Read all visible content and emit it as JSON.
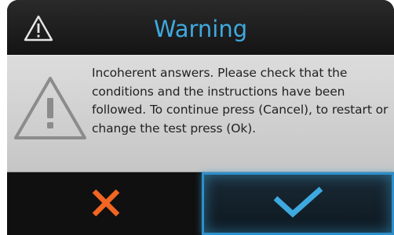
{
  "dialog": {
    "title": "Warning",
    "message": "Incoherent answers. Please check that the conditions and the instructions have been followed. To continue press (Cancel), to restart or change the test press (Ok).",
    "title_color": "#3ea9df"
  },
  "buttons": {
    "cancel": {
      "icon": "close-icon",
      "color": "#f26522"
    },
    "ok": {
      "icon": "checkmark-icon",
      "color": "#3ea9df"
    }
  },
  "icons": {
    "header": "warning-triangle-icon",
    "body": "warning-triangle-icon"
  }
}
